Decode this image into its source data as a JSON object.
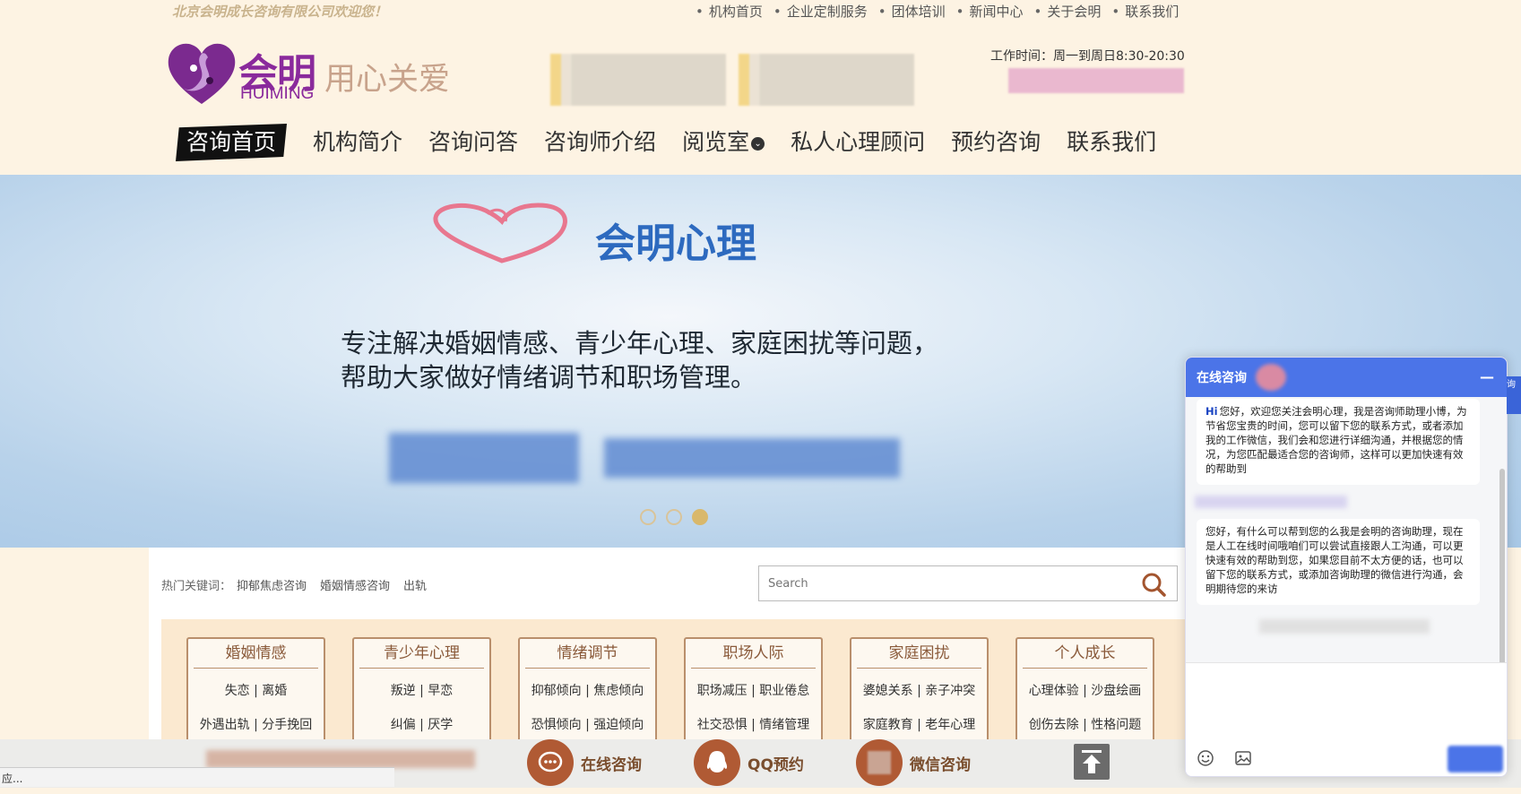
{
  "header": {
    "welcome": "北京会明成长咨询有限公司欢迎您！",
    "toplinks": [
      "机构首页",
      "企业定制服务",
      "团体培训",
      "新闻中心",
      "关于会明",
      "联系我们"
    ],
    "logo": {
      "cn": "会明",
      "en": "HUIMING",
      "slogan": "用心关爱"
    },
    "worktime": "工作时间：周一到周日8:30-20:30",
    "nav": [
      {
        "label": "咨询首页",
        "active": true
      },
      {
        "label": "机构简介"
      },
      {
        "label": "咨询问答"
      },
      {
        "label": "咨询师介绍"
      },
      {
        "label": "阅览室"
      },
      {
        "label": "私人心理顾问"
      },
      {
        "label": "预约咨询"
      },
      {
        "label": "联系我们"
      }
    ]
  },
  "banner": {
    "title": "会明心理",
    "line1": "专注解决婚姻情感、青少年心理、家庭困扰等问题，",
    "line2": "帮助大家做好情绪调节和职场管理。",
    "slides": 3,
    "active_slide": 3
  },
  "hotwords": {
    "label": "热门关键词：",
    "items": [
      "抑郁焦虑咨询",
      "婚姻情感咨询",
      "出轨"
    ]
  },
  "search": {
    "placeholder": "Search"
  },
  "categories": [
    {
      "title": "婚姻情感",
      "row1": "失恋 | 离婚",
      "row2": "外遇出轨 | 分手挽回"
    },
    {
      "title": "青少年心理",
      "row1": "叛逆 | 早恋",
      "row2": "纠偏 | 厌学"
    },
    {
      "title": "情绪调节",
      "row1": "抑郁倾向 | 焦虑倾向",
      "row2": "恐惧倾向 | 强迫倾向"
    },
    {
      "title": "职场人际",
      "row1": "职场减压 | 职业倦怠",
      "row2": "社交恐惧 | 情绪管理"
    },
    {
      "title": "家庭困扰",
      "row1": "婆媳关系 | 亲子冲突",
      "row2": "家庭教育 | 老年心理"
    },
    {
      "title": "个人成长",
      "row1": "心理体验 | 沙盘绘画",
      "row2": "创伤去除 | 性格问题"
    }
  ],
  "bottombar": {
    "online": "在线咨询",
    "qq": "QQ预约",
    "wechat": "微信咨询"
  },
  "status": "应...",
  "chat": {
    "title": "在线咨询",
    "msg1": "您好，欢迎您关注会明心理，我是咨询师助理小博，为节省您宝贵的时间，您可以留下您的联系方式，或者添加我的工作微信，我们会和您进行详细沟通，并根据您的情况，为您匹配最适合您的咨询师，这样可以更加快速有效的帮助到",
    "msg1_hi": "Hi",
    "msg2": "您好，有什么可以帮到您的么我是会明的咨询助理，现在是人工在线时间哦咱们可以尝试直接跟人工沟通，可以更快速有效的帮助到您，如果您目前不太方便的话，也可以留下您的联系方式，或添加咨询助理的微信进行沟通，会明期待您的来访",
    "side_tab": "询"
  },
  "colors": {
    "header_bg": "#fdf3e3",
    "brand_purple": "#8a2a9c",
    "chat_blue": "#4b74e8",
    "bottom_brown": "#b05a34"
  }
}
